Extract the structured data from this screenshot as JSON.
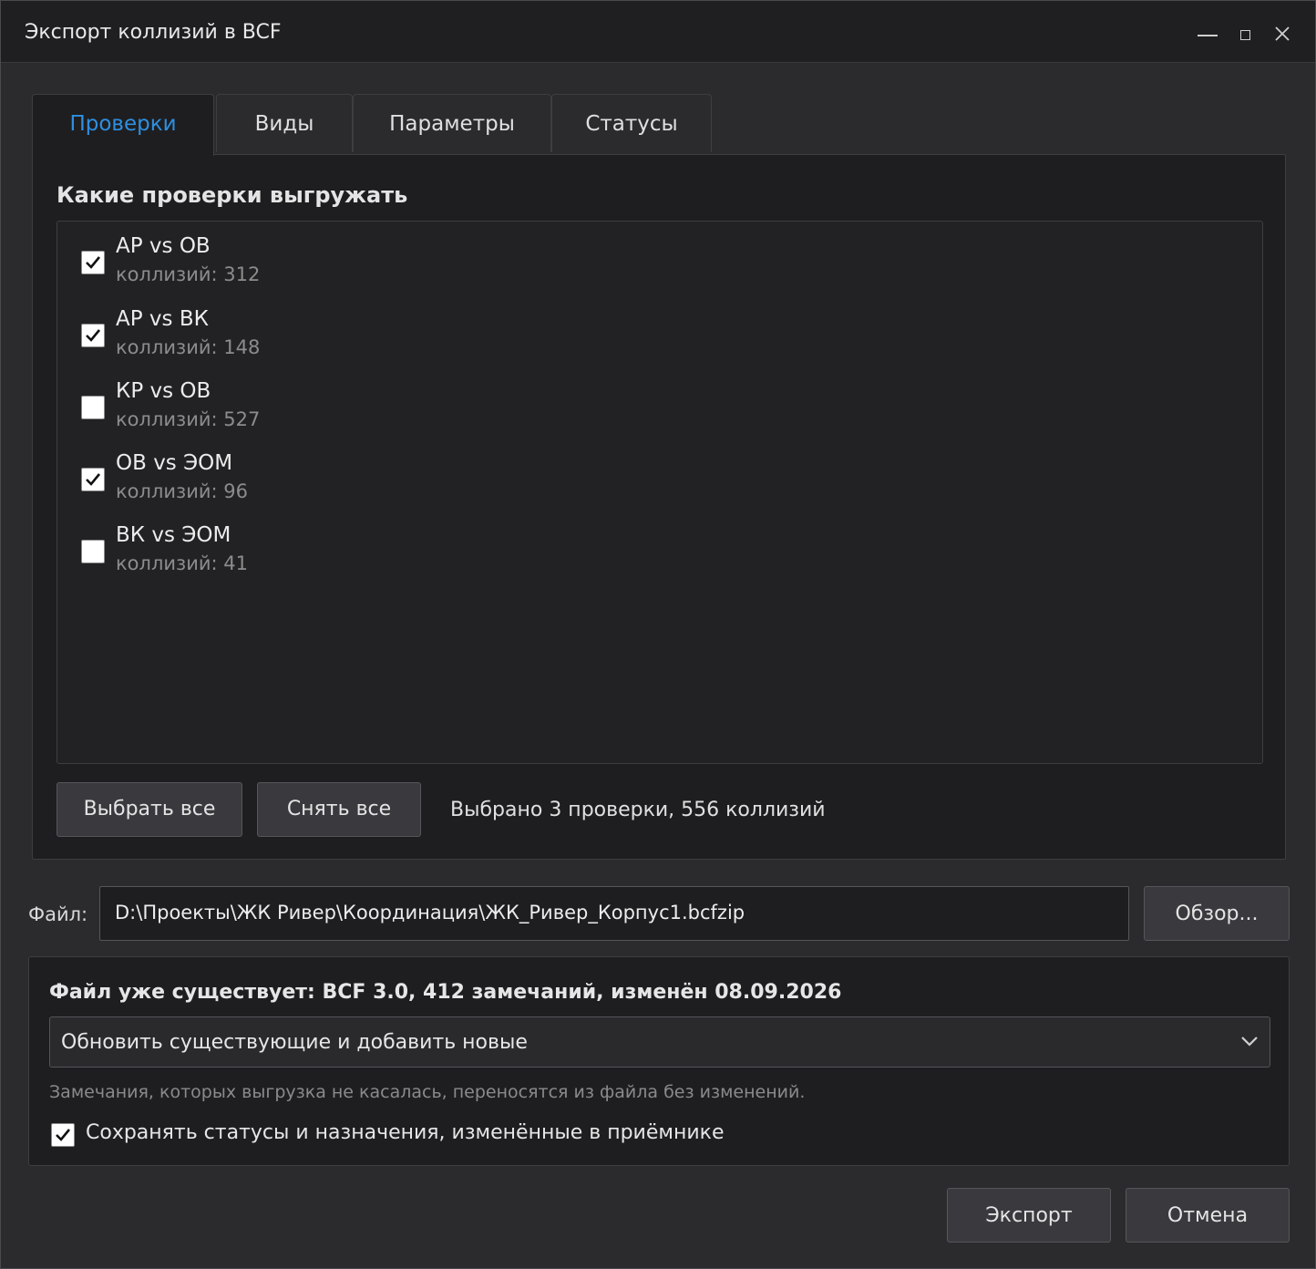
{
  "window": {
    "title": "Экспорт коллизий в BCF",
    "controls": {
      "minimize": "minimize-icon",
      "maximize": "maximize-icon",
      "close": "close-icon"
    }
  },
  "tabs": [
    {
      "label": "Проверки",
      "active": true
    },
    {
      "label": "Виды",
      "active": false
    },
    {
      "label": "Параметры",
      "active": false
    },
    {
      "label": "Статусы",
      "active": false
    }
  ],
  "checks": {
    "title": "Какие проверки выгружать",
    "items": [
      {
        "name": "АР vs ОВ",
        "count": "коллизий: 312",
        "checked": true
      },
      {
        "name": "АР vs ВК",
        "count": "коллизий: 148",
        "checked": true
      },
      {
        "name": "КР vs ОВ",
        "count": "коллизий: 527",
        "checked": false
      },
      {
        "name": "ОВ vs ЭОМ",
        "count": "коллизий: 96",
        "checked": true
      },
      {
        "name": "ВК vs ЭОМ",
        "count": "коллизий: 41",
        "checked": false
      }
    ],
    "select_all_label": "Выбрать все",
    "clear_all_label": "Снять все",
    "summary": "Выбрано 3 проверки, 556 коллизий"
  },
  "file": {
    "label": "Файл:",
    "value": "D:\\Проекты\\ЖК Ривер\\Координация\\ЖК_Ривер_Корпус1.bcfzip",
    "browse_label": "Обзор..."
  },
  "existing": {
    "title": "Файл уже существует: BCF 3.0, 412 замечаний, изменён 08.09.2026",
    "mode_selected": "Обновить существующие и добавить новые",
    "hint": "Замечания, которых выгрузка не касалась, переносятся из файла без изменений.",
    "keep_label": "Сохранять статусы и назначения, изменённые в приёмнике",
    "keep_checked": true
  },
  "footer": {
    "export_label": "Экспорт",
    "cancel_label": "Отмена"
  },
  "colors": {
    "accent": "#2f8fe0",
    "background": "#2b2b2e",
    "panel": "#1e1e20"
  }
}
